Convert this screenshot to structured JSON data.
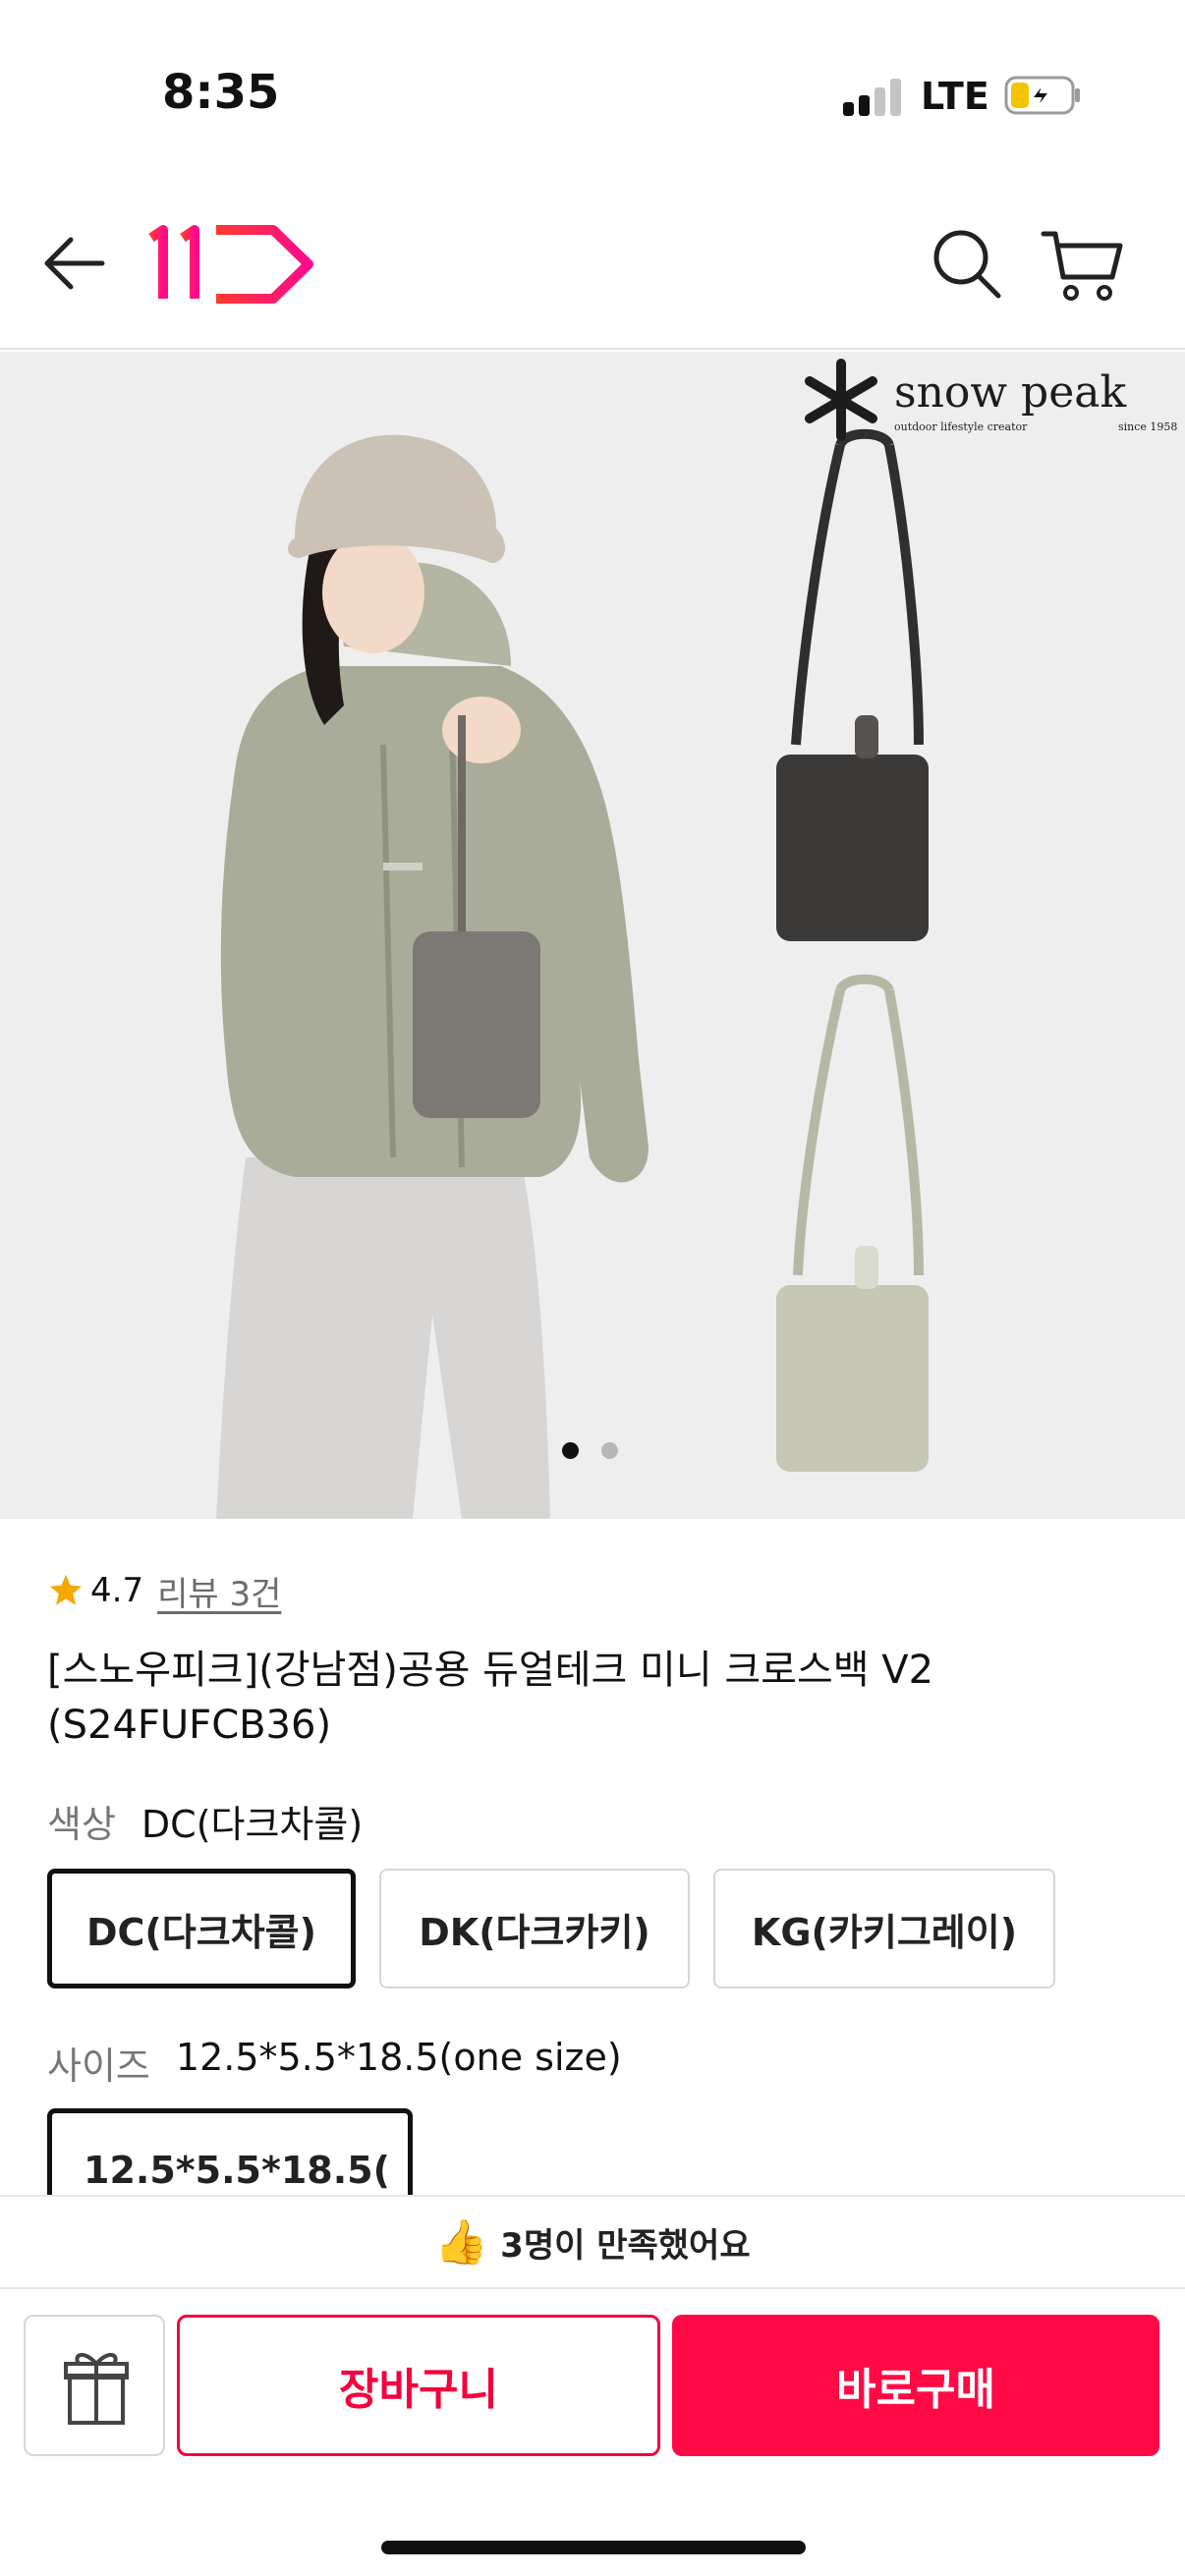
{
  "status_bar": {
    "time": "8:35",
    "network": "LTE",
    "signal_bars_active": 2,
    "signal_bars_total": 4,
    "battery_state": "charging-low"
  },
  "header": {
    "back_icon": "arrow-left-icon",
    "logo_text": "11",
    "search_icon": "search-icon",
    "cart_icon": "cart-icon",
    "accent_color": "#ff0a45"
  },
  "gallery": {
    "brand_name": "snow peak",
    "brand_tagline": "outdoor lifestyle creator",
    "brand_since": "since 1958",
    "current_slide": 1,
    "total_slides": 2
  },
  "product": {
    "rating": "4.7",
    "review_link": "리뷰 3건",
    "title": "[스노우피크](강남점)공용 듀얼테크 미니 크로스백 V2 (S24FUFCB36)"
  },
  "options": {
    "color_label": "색상",
    "color_selected": "DC(다크차콜)",
    "colors": [
      "DC(다크차콜)",
      "DK(다크카키)",
      "KG(카키그레이)"
    ],
    "size_label": "사이즈",
    "size_selected": "12.5*5.5*18.5(one size)",
    "size_button": "12.5*5.5*18.5("
  },
  "bottom_bar": {
    "satisfaction": "3명이 만족했어요",
    "gift_icon": "gift-icon",
    "add_to_cart": "장바구니",
    "buy_now": "바로구매",
    "brand_color": "#ff0a45"
  }
}
